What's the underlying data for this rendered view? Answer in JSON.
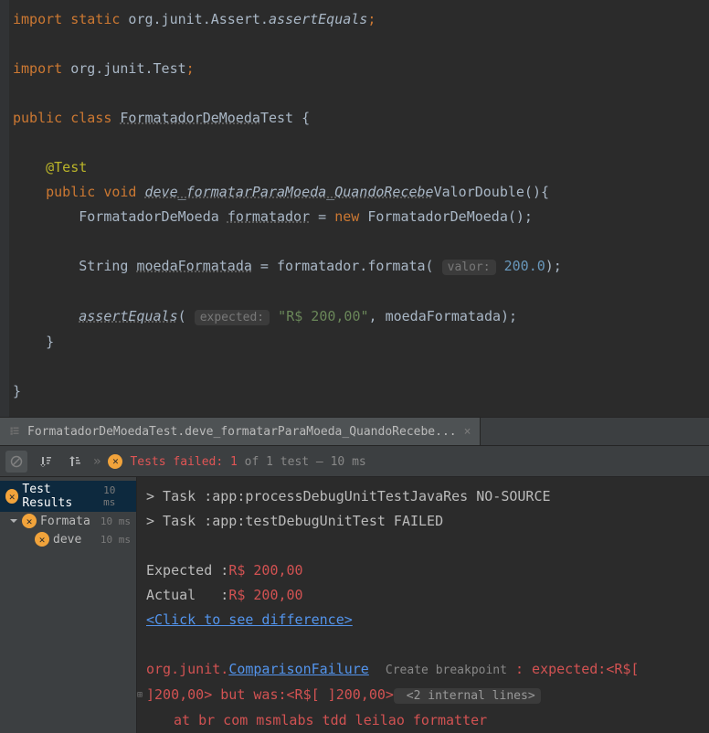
{
  "code": {
    "line1_kw_import": "import",
    "line1_kw_static": "static",
    "line1_pkg": " org.junit.Assert.",
    "line1_method": "assertEquals",
    "line1_semi": ";",
    "line2_kw_import": "import",
    "line2_pkg": " org.junit.",
    "line2_class": "Test",
    "line2_semi": ";",
    "line3_public": "public",
    "line3_class": "class",
    "line3_name1": "FormatadorDeMoeda",
    "line3_name2": "Test",
    "line3_brace": " {",
    "line4_ann": "@Test",
    "line5_public": "public",
    "line5_void": "void",
    "line5_m1": "deve_formatarParaMoeda_QuandoRecebe",
    "line5_m2": "ValorDouble",
    "line5_tail": "(){",
    "line6a": "        FormatadorDeMoeda ",
    "line6_var": "formatador",
    "line6b": " = ",
    "line6_new": "new",
    "line6c": " FormatadorDeMoeda();",
    "line7a": "        String ",
    "line7_var": "moedaFormatada",
    "line7b": " = formatador.formata( ",
    "line7_hint": "valor:",
    "line7_num": " 200.0",
    "line7c": ");",
    "line8a": "        ",
    "line8_assert": "assertEquals",
    "line8_paren": "( ",
    "line8_hint": "expected:",
    "line8_str": " \"R$ 200,00\"",
    "line8b": ", moedaFormatada);",
    "line9": "    }",
    "line10": "}"
  },
  "tab": {
    "label": "FormatadorDeMoedaTest.deve_formatarParaMoeda_QuandoRecebe..."
  },
  "toolbar": {
    "tests_failed": "Tests failed: 1",
    "tests_suffix": " of 1 test – 10 ms",
    "chevrons": "»"
  },
  "tree": {
    "root_label": "Test Results",
    "root_time": "10 ms",
    "node1_label": "Formata",
    "node1_time": "10 ms",
    "node2_label": "deve",
    "node2_time": "10 ms"
  },
  "console": {
    "l1": "> Task :app:processDebugUnitTestJavaRes NO-SOURCE",
    "l2": "> Task :app:testDebugUnitTest FAILED",
    "l3a": "Expected :",
    "l3b": "R$ 200,00",
    "l4a": "Actual   :",
    "l4b": "R$ 200,00",
    "l5": "<Click to see difference>",
    "l6a": "org.junit.",
    "l6b": "ComparisonFailure",
    "l6c": "Create breakpoint",
    "l6d": " : expected:<R$[ ",
    "l7a": "]200,00> but was:<R$[ ]200,00>",
    "l7b": " <2 internal lines>",
    "l8": "at br com msmlabs tdd leilao formatter"
  }
}
